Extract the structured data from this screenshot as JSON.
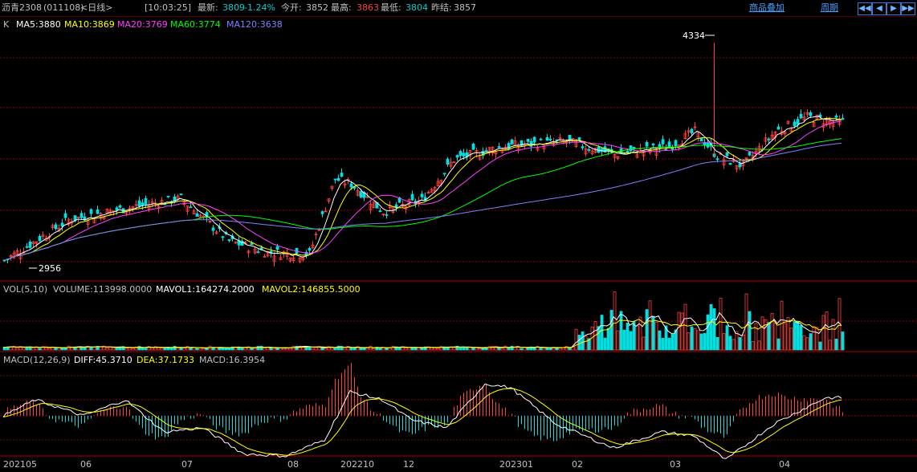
{
  "colors": {
    "up": "#ff4040",
    "down": "#00e0e0",
    "ma5": "#ffffff",
    "ma10": "#ffff00",
    "ma20": "#ff40ff",
    "ma60": "#00ff00",
    "ma120": "#8080ff",
    "grid": "#8b0000",
    "text": "#c0c0c0",
    "link": "#40a0ff"
  },
  "header": {
    "instrument": "沥青2308",
    "code": "(011108)",
    "period": "<日线>",
    "time": "[10:03:25]",
    "last_label": "最新:",
    "last_value": "3809",
    "change": "-1.24%",
    "open_label": "今开:",
    "open_value": "3852",
    "high_label": "最高:",
    "high_value": "3863",
    "low_label": "最低:",
    "low_value": "3804",
    "prev_label": "昨结:",
    "prev_value": "3857",
    "overlay_link": "商品叠加",
    "period_link": "周期",
    "nav_icons": [
      "rewind-icon",
      "prev-icon",
      "next-icon",
      "forward-icon"
    ]
  },
  "price_panel": {
    "prefix": "K",
    "ma": [
      {
        "label": "MA5:3880",
        "key": "ma5"
      },
      {
        "label": "MA10:3869",
        "key": "ma10"
      },
      {
        "label": "MA20:3769",
        "key": "ma20"
      },
      {
        "label": "MA60:3774",
        "key": "ma60"
      },
      {
        "label": "MA120:3638",
        "key": "ma120"
      }
    ],
    "high_marker": "4334",
    "low_marker": "2956"
  },
  "volume_panel": {
    "label": "VOL(5,10)",
    "volume": "VOLUME:113998.0000",
    "mavol1": "MAVOL1:164274.2000",
    "mavol2": "MAVOL2:146855.5000"
  },
  "macd_panel": {
    "label": "MACD(12,26,9)",
    "diff": "DIFF:45.3710",
    "dea": "DEA:37.1733",
    "macd": "MACD:16.3954"
  },
  "x_axis": [
    "202105",
    "06",
    "07",
    "08",
    "202210",
    "12",
    "202301",
    "02",
    "03",
    "04"
  ],
  "chart_data": {
    "type": "candlestick",
    "price_anchor_points": [
      [
        0,
        3000
      ],
      [
        20,
        3250
      ],
      [
        40,
        3330
      ],
      [
        55,
        3380
      ],
      [
        70,
        3120
      ],
      [
        82,
        3050
      ],
      [
        95,
        3040
      ],
      [
        103,
        3500
      ],
      [
        108,
        3470
      ],
      [
        118,
        3300
      ],
      [
        130,
        3370
      ],
      [
        140,
        3620
      ],
      [
        155,
        3700
      ],
      [
        175,
        3730
      ],
      [
        190,
        3650
      ],
      [
        207,
        3700
      ],
      [
        215,
        3790
      ],
      [
        222,
        3640
      ],
      [
        230,
        3580
      ],
      [
        240,
        3790
      ],
      [
        250,
        3880
      ],
      [
        258,
        3850
      ]
    ],
    "period_high": 4334,
    "period_low": 2956,
    "macd_anchor_points": [
      [
        0,
        0
      ],
      [
        10,
        40
      ],
      [
        25,
        0
      ],
      [
        38,
        40
      ],
      [
        50,
        -40
      ],
      [
        62,
        -30
      ],
      [
        75,
        -95
      ],
      [
        88,
        -100
      ],
      [
        100,
        -60
      ],
      [
        108,
        60
      ],
      [
        118,
        40
      ],
      [
        127,
        -10
      ],
      [
        138,
        -30
      ],
      [
        150,
        80
      ],
      [
        158,
        70
      ],
      [
        172,
        -20
      ],
      [
        190,
        -80
      ],
      [
        205,
        -40
      ],
      [
        215,
        -50
      ],
      [
        225,
        -110
      ],
      [
        240,
        -20
      ],
      [
        256,
        45
      ]
    ]
  }
}
